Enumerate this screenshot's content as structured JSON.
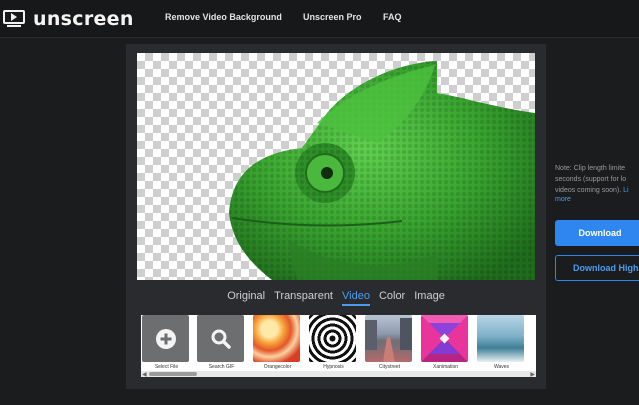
{
  "brand": {
    "name": "unscreen"
  },
  "nav": {
    "items": [
      {
        "label": "Remove Video Background"
      },
      {
        "label": "Unscreen Pro"
      },
      {
        "label": "FAQ"
      }
    ]
  },
  "preview": {
    "tabs": [
      {
        "label": "Original",
        "active": false
      },
      {
        "label": "Transparent",
        "active": false
      },
      {
        "label": "Video",
        "active": true
      },
      {
        "label": "Color",
        "active": false
      },
      {
        "label": "Image",
        "active": false
      }
    ]
  },
  "backgrounds": {
    "items": [
      {
        "label": "Select File",
        "icon": "plus-icon"
      },
      {
        "label": "Search GIF",
        "icon": "search-icon"
      },
      {
        "label": "Orangecolor"
      },
      {
        "label": "Hypnosis"
      },
      {
        "label": "Citystreet"
      },
      {
        "label": "Xanimation"
      },
      {
        "label": "Waves"
      }
    ]
  },
  "side": {
    "note_line1": "Note: Clip length limite",
    "note_line2": "seconds (support for lo",
    "note_line3": "videos coming soon). ",
    "note_link": "Li",
    "more_link": "more",
    "download_label": "Download",
    "download_high_label": "Download High"
  },
  "colors": {
    "accent": "#2f86ee",
    "background": "#1b1c1e",
    "panel": "#2a2b2e",
    "subject": "#3fae36"
  }
}
